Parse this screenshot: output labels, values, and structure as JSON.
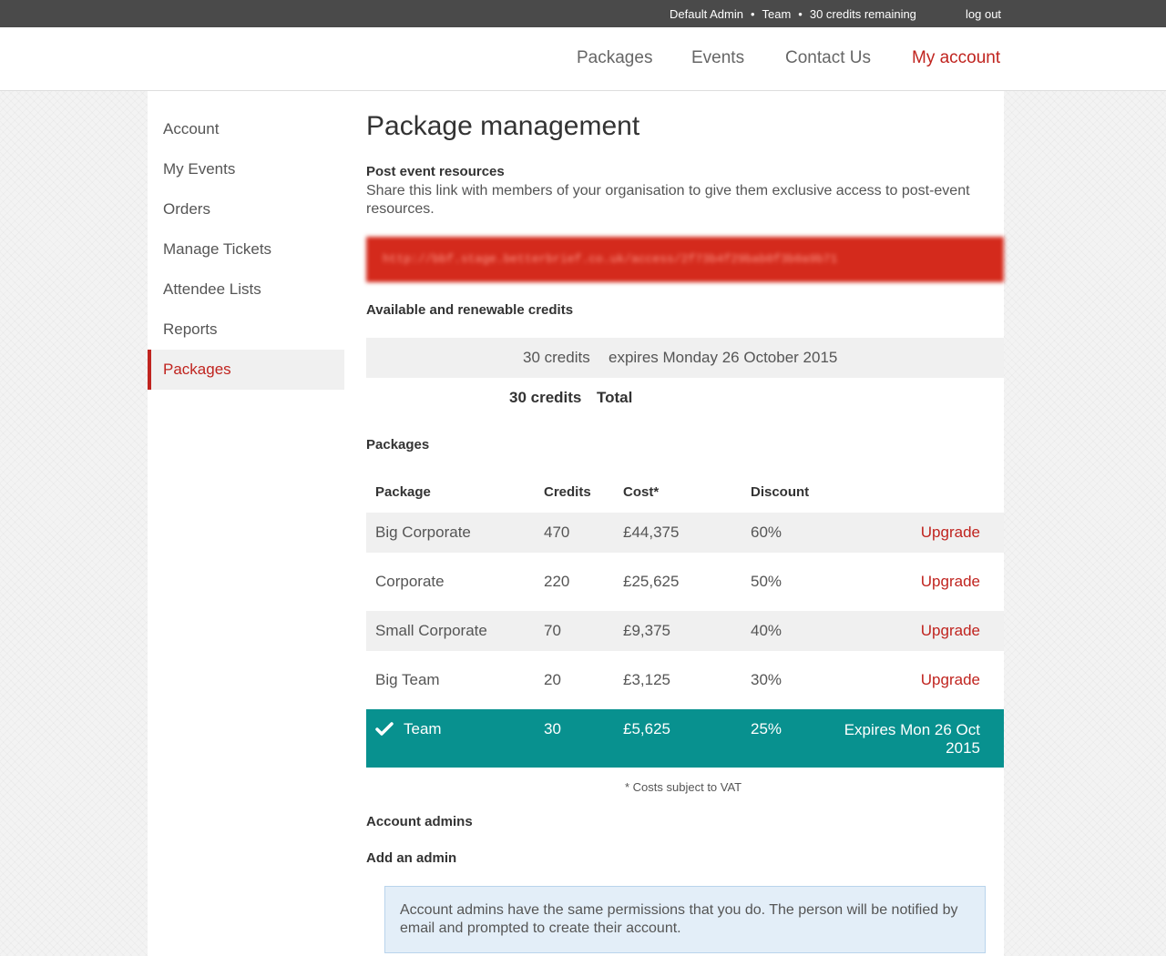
{
  "topbar": {
    "user": "Default Admin",
    "team": "Team",
    "credits_remaining": "30 credits remaining",
    "separator": "•",
    "logout": "log out"
  },
  "nav": {
    "items": [
      "Packages",
      "Events",
      "Contact Us",
      "My account"
    ]
  },
  "sidebar": {
    "items": [
      {
        "label": "Account"
      },
      {
        "label": "My Events"
      },
      {
        "label": "Orders"
      },
      {
        "label": "Manage Tickets"
      },
      {
        "label": "Attendee Lists"
      },
      {
        "label": "Reports"
      },
      {
        "label": "Packages",
        "active": true
      }
    ]
  },
  "main": {
    "title": "Package management",
    "post_event": {
      "heading": "Post event resources",
      "description": "Share this link with members of your organisation to give them exclusive access to post-event resources."
    },
    "credits": {
      "heading": "Available and renewable credits",
      "row_amount": "30 credits",
      "row_expiry": "expires Monday 26 October 2015",
      "total_amount": "30 credits",
      "total_label": "Total"
    },
    "packages": {
      "heading": "Packages",
      "columns": [
        "Package",
        "Credits",
        "Cost*",
        "Discount"
      ],
      "rows": [
        {
          "name": "Big Corporate",
          "credits": "470",
          "cost": "£44,375",
          "discount": "60%",
          "action": "Upgrade"
        },
        {
          "name": "Corporate",
          "credits": "220",
          "cost": "£25,625",
          "discount": "50%",
          "action": "Upgrade"
        },
        {
          "name": "Small Corporate",
          "credits": "70",
          "cost": "£9,375",
          "discount": "40%",
          "action": "Upgrade"
        },
        {
          "name": "Big Team",
          "credits": "20",
          "cost": "£3,125",
          "discount": "30%",
          "action": "Upgrade"
        },
        {
          "name": "Team",
          "credits": "30",
          "cost": "£5,625",
          "discount": "25%",
          "action_line1": "Expires Mon 26 Oct",
          "action_line2": "2015"
        }
      ],
      "vat_note": "* Costs subject to VAT"
    },
    "admins": {
      "heading": "Account admins",
      "add_heading": "Add an admin",
      "info": "Account admins have the same permissions that you do. The person will be notified by email and prompted to create their account."
    }
  },
  "colors": {
    "accent": "#c0241f",
    "current_package": "#08918f",
    "info_box": "#e3eef8",
    "topbar": "#4a4a4a"
  }
}
